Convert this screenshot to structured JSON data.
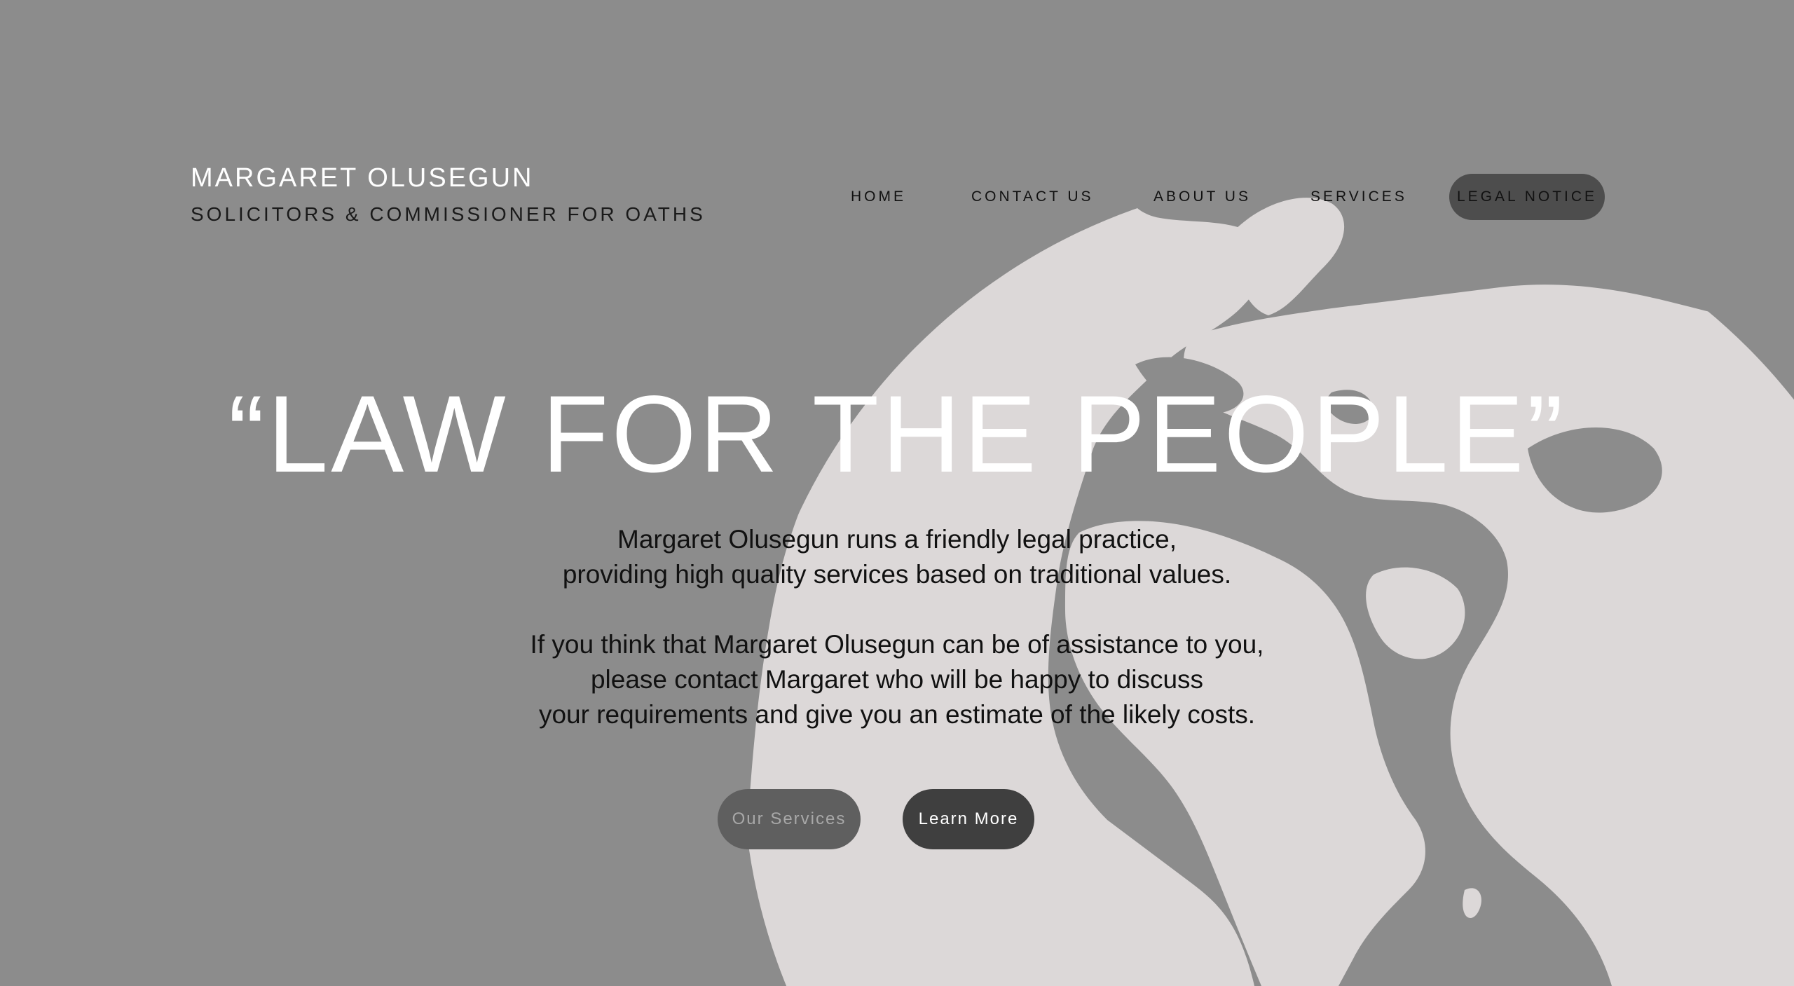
{
  "colors": {
    "background": "#8c8c8c",
    "globe": "#dcd8d8",
    "accent_dark": "#4d4d4d"
  },
  "brand": {
    "name": "MARGARET OLUSEGUN",
    "tagline": "SOLICITORS & COMMISSIONER FOR OATHS"
  },
  "nav": {
    "items": [
      {
        "label": "HOME"
      },
      {
        "label": "CONTACT US"
      },
      {
        "label": "ABOUT US"
      },
      {
        "label": "SERVICES"
      },
      {
        "label": "LEGAL NOTICE"
      }
    ]
  },
  "hero": {
    "headline": "“LAW FOR THE PEOPLE”",
    "paragraph1": [
      "Margaret Olusegun runs a friendly legal practice,",
      "providing high quality services based on traditional values."
    ],
    "paragraph2": [
      "If you think that Margaret Olusegun can be of assistance to you,",
      "please contact Margaret who will be happy to discuss",
      "your requirements and give you an estimate of the likely costs."
    ],
    "buttons": {
      "our_services": "Our Services",
      "learn_more": "Learn More"
    }
  },
  "decor": {
    "background_graphic": "globe-icon"
  }
}
